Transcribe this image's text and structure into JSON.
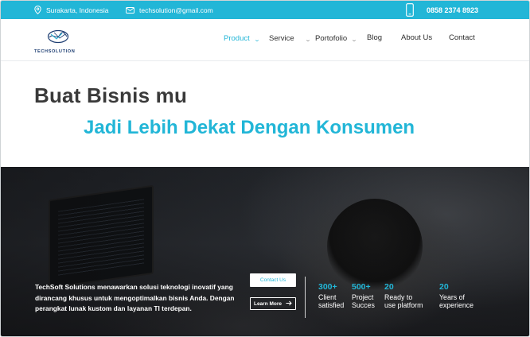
{
  "topbar": {
    "location": "Surakarta, Indonesia",
    "email": "techsolution@gmail.com",
    "phone": "0858 2374 8923",
    "icons": {
      "location": "location-pin-icon",
      "email": "envelope-icon",
      "phone": "smartphone-icon"
    }
  },
  "logo": {
    "text": "TECHSOLUTION"
  },
  "nav": {
    "items": [
      {
        "label": "Product",
        "dropdown": true,
        "active": true
      },
      {
        "label": "Service",
        "dropdown": true,
        "active": false
      },
      {
        "label": "Portofolio",
        "dropdown": true,
        "active": false
      },
      {
        "label": "Blog",
        "dropdown": false,
        "active": false
      },
      {
        "label": "About Us",
        "dropdown": false,
        "active": false
      },
      {
        "label": "Contact",
        "dropdown": false,
        "active": false
      }
    ]
  },
  "hero": {
    "line1": "Buat Bisnis mu",
    "line2": "Jadi Lebih Dekat Dengan Konsumen",
    "description": "TechSoft Solutions menawarkan solusi teknologi inovatif yang dirancang khusus untuk mengoptimalkan bisnis Anda. Dengan perangkat lunak kustom dan layanan TI terdepan.",
    "contact_button": "Contact Us",
    "learn_button": "Learn More"
  },
  "stats": [
    {
      "number": "300+",
      "label": "Client\nsatisfied"
    },
    {
      "number": "500+",
      "label": "Project\nSucces"
    },
    {
      "number": "20",
      "label": "Ready to\nuse platform"
    },
    {
      "number": "20",
      "label": "Years of\nexperience"
    }
  ],
  "colors": {
    "accent": "#22b6d7",
    "heading": "#3a3a3a",
    "logo": "#1f3f73"
  }
}
